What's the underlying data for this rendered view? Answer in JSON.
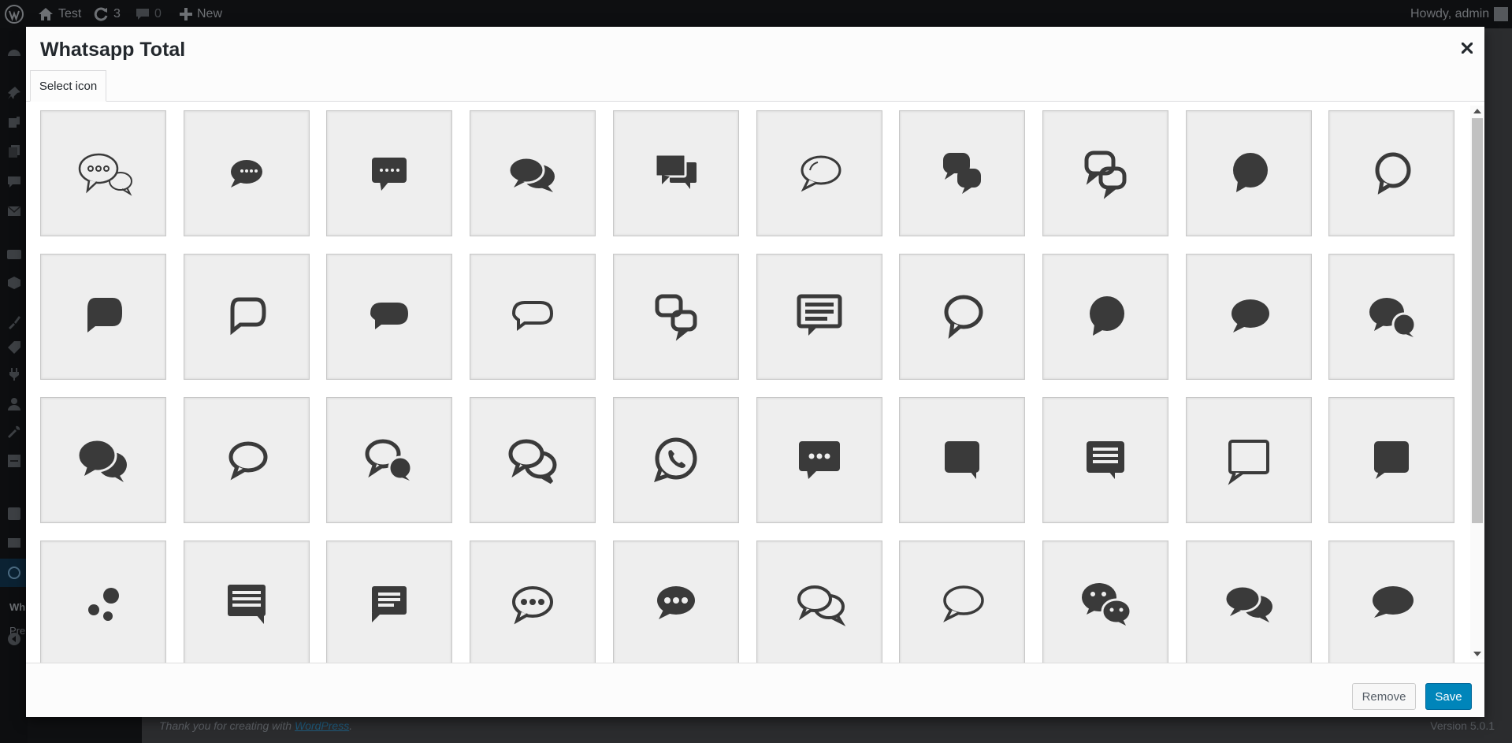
{
  "adminbar": {
    "site_name": "Test",
    "updates_count": "3",
    "comments_count": "0",
    "new_label": "New",
    "greeting": "Howdy, admin"
  },
  "sidemenu": {
    "sub_title": "Wh",
    "sub_item": "Pre"
  },
  "modal": {
    "title": "Whatsapp Total",
    "tab_label": "Select icon",
    "remove_label": "Remove",
    "save_label": "Save",
    "icon_color": "#3a3a3a",
    "accent": "#0085ba"
  },
  "icons": [
    "three-dot-double-bubble-outline-icon",
    "dots-bubble-small-icon",
    "dots-square-bubble-icon",
    "double-bubble-solid-icon",
    "double-square-bubble-icon",
    "oval-bubble-outline-icon",
    "linked-bubbles-solid-icon",
    "linked-bubbles-outline-icon",
    "round-bubble-solid-icon",
    "round-bubble-outline-icon",
    "rounded-square-bubble-solid-icon",
    "rounded-square-bubble-outline-icon",
    "wide-bubble-solid-icon",
    "wide-bubble-outline-icon",
    "linked-squares-outline-icon",
    "text-lines-square-bubble-icon",
    "round-bubble-thick-outline-icon",
    "round-bubble-solid-icon",
    "oval-bubble-solid-icon",
    "bubble-pair-solid-icon",
    "double-bubble-solid-large-icon",
    "oval-bubble-thick-outline-icon",
    "bubble-pair-outline-icon",
    "double-bubble-outline-icon",
    "whatsapp-icon",
    "dots-square-bubble-large-icon",
    "square-bubble-solid-icon",
    "text-lines-square-bubble-large-icon",
    "square-bubble-outline-icon",
    "square-bubble-solid-right-icon",
    "scattered-dots-icon",
    "material-text-bubble-icon",
    "material-text-bubble-small-icon",
    "dots-oval-bubble-outline-icon",
    "dots-oval-bubble-solid-icon",
    "double-oval-outline-icon",
    "oval-bubble-thin-outline-icon",
    "wechat-icon",
    "double-oval-solid-icon",
    "oval-bubble-solid-left-icon"
  ],
  "footer": {
    "thanks_prefix": "Thank you for creating with ",
    "wordpress_link": "WordPress",
    "thanks_suffix": ".",
    "version": "Version 5.0.1"
  }
}
